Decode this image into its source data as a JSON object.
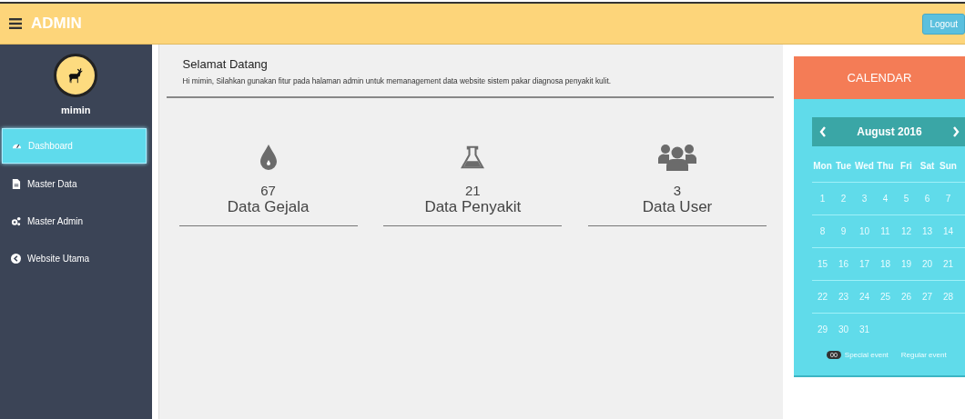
{
  "topbar": {
    "title": "ADMIN",
    "logout": "Logout"
  },
  "sidebar": {
    "user": "mimin",
    "items": [
      {
        "label": "Dashboard",
        "kind": "dashboard",
        "selected": true
      },
      {
        "label": "Master Data",
        "kind": "file",
        "selected": false
      },
      {
        "label": "Master Admin",
        "kind": "gears",
        "selected": false
      },
      {
        "label": "Website Utama",
        "kind": "back",
        "selected": false
      }
    ]
  },
  "welcome": {
    "title": "Selamat Datang",
    "text": "Hi mimin, Silahkan gunakan fitur pada halaman admin untuk memanagement data website sistem pakar diagnosa penyakit kulit."
  },
  "stats": [
    {
      "kind": "drop",
      "count": "67",
      "label": "Data Gejala"
    },
    {
      "kind": "flask",
      "count": "21",
      "label": "Data Penyakit"
    },
    {
      "kind": "users",
      "count": "3",
      "label": "Data User"
    }
  ],
  "calendar": {
    "title": "CALENDAR",
    "month": "August 2016",
    "weekdays": [
      "Mon",
      "Tue",
      "Wed",
      "Thu",
      "Fri",
      "Sat",
      "Sun"
    ],
    "weeks": [
      [
        "1",
        "2",
        "3",
        "4",
        "5",
        "6",
        "7"
      ],
      [
        "8",
        "9",
        "10",
        "11",
        "12",
        "13",
        "14"
      ],
      [
        "15",
        "16",
        "17",
        "18",
        "19",
        "20",
        "21"
      ],
      [
        "22",
        "23",
        "24",
        "25",
        "26",
        "27",
        "28"
      ],
      [
        "29",
        "30",
        "31"
      ]
    ],
    "legend": {
      "badge": "00",
      "special": "Special event",
      "regular": "Regular event"
    }
  }
}
